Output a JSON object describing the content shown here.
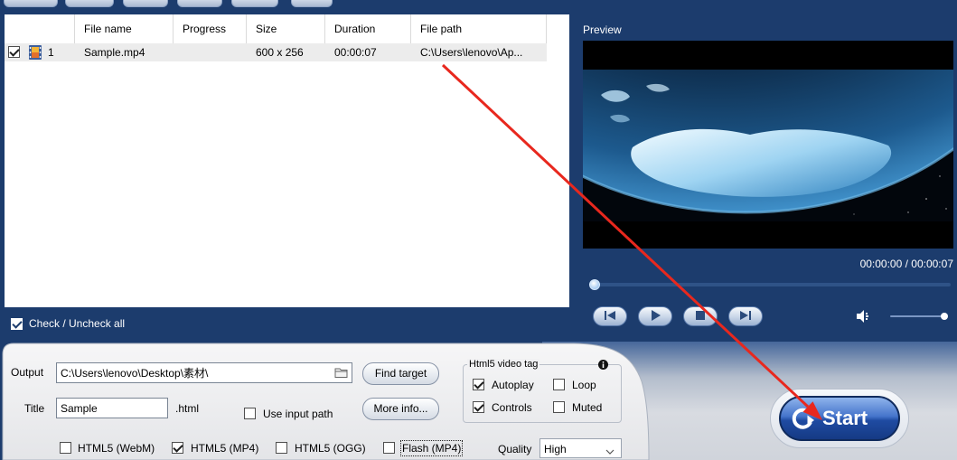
{
  "window": {
    "colors": {
      "background": "#1c3c6d",
      "start_button": "#2b5cb8",
      "annotation_arrow": "#e8281e"
    }
  },
  "file_list": {
    "columns": {
      "file_name": "File name",
      "progress": "Progress",
      "size": "Size",
      "duration": "Duration",
      "file_path": "File path"
    },
    "rows": [
      {
        "checked": true,
        "icon": "film-icon",
        "index": "1",
        "file_name": "Sample.mp4",
        "progress": "",
        "size": "600 x 256",
        "duration": "00:00:07",
        "file_path": "C:\\Users\\lenovo\\Ap..."
      }
    ],
    "check_all": {
      "label": "Check / Uncheck all",
      "checked": true
    }
  },
  "preview": {
    "label": "Preview",
    "time": "00:00:00 / 00:00:07",
    "playback_position": 0,
    "volume_level": 1,
    "controls": {
      "prev": "prev-icon",
      "play": "play-icon",
      "stop": "stop-icon",
      "next": "next-icon"
    },
    "volume_icon": "speaker-icon"
  },
  "settings": {
    "output": {
      "label": "Output",
      "value": "C:\\Users\\lenovo\\Desktop\\素材\\",
      "browse_icon": "folder-icon"
    },
    "find_target_label": "Find target",
    "title": {
      "label": "Title",
      "value": "Sample",
      "extension": ".html"
    },
    "use_input_path": {
      "label": "Use input path",
      "checked": false
    },
    "more_info_label": "More info...",
    "video_tag": {
      "legend": "Html5 video tag",
      "info_icon": "info-icon",
      "options": [
        {
          "label": "Autoplay",
          "checked": true
        },
        {
          "label": "Loop",
          "checked": false
        },
        {
          "label": "Controls",
          "checked": true
        },
        {
          "label": "Muted",
          "checked": false
        }
      ]
    },
    "formats": [
      {
        "label": "HTML5 (WebM)",
        "checked": false
      },
      {
        "label": "HTML5 (MP4)",
        "checked": true
      },
      {
        "label": "HTML5 (OGG)",
        "checked": false
      },
      {
        "label": "Flash (MP4)",
        "checked": false,
        "focused": true
      }
    ],
    "quality": {
      "label": "Quality",
      "value": "High",
      "dropdown_icon": "chevron-down-icon"
    }
  },
  "start_button": {
    "label": "Start",
    "icon": "convert-arrow-icon"
  }
}
